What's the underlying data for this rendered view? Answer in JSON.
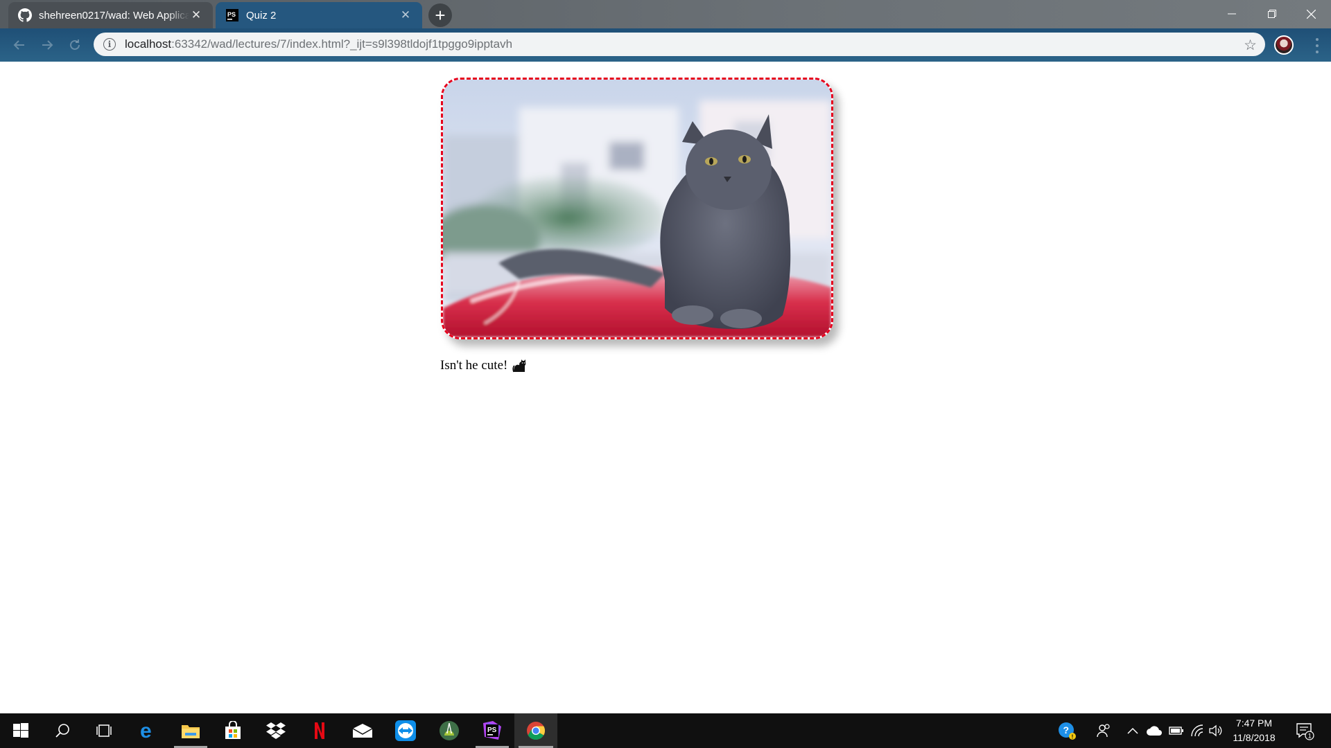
{
  "browser": {
    "tabs": [
      {
        "title": "shehreen0217/wad: Web Applica",
        "favicon": "github-icon",
        "active": false
      },
      {
        "title": "Quiz 2",
        "favicon": "phpstorm-icon",
        "active": true
      }
    ],
    "new_tab_label": "+",
    "address": {
      "host": "localhost",
      "rest": ":63342/wad/lectures/7/index.html?_ijt=s9l398tldojf1tpggo9ipptavh"
    },
    "info_glyph": "i",
    "star_glyph": "☆",
    "tab_close_glyph": "✕"
  },
  "page": {
    "image_alt": "cat",
    "frame_border_color": "#e6001c",
    "caption": "Isn't he cute!",
    "caption_emoji": "cat-emoji"
  },
  "taskbar": {
    "apps": [
      "start-icon",
      "search-icon",
      "task-view-icon",
      "edge-icon",
      "file-explorer-icon",
      "store-icon",
      "dropbox-icon",
      "netflix-icon",
      "mail-icon",
      "teamviewer-icon",
      "android-studio-icon",
      "phpstorm-icon",
      "chrome-icon"
    ],
    "clock": {
      "time": "7:47 PM",
      "date": "11/8/2018"
    },
    "notifications_count": "1"
  }
}
